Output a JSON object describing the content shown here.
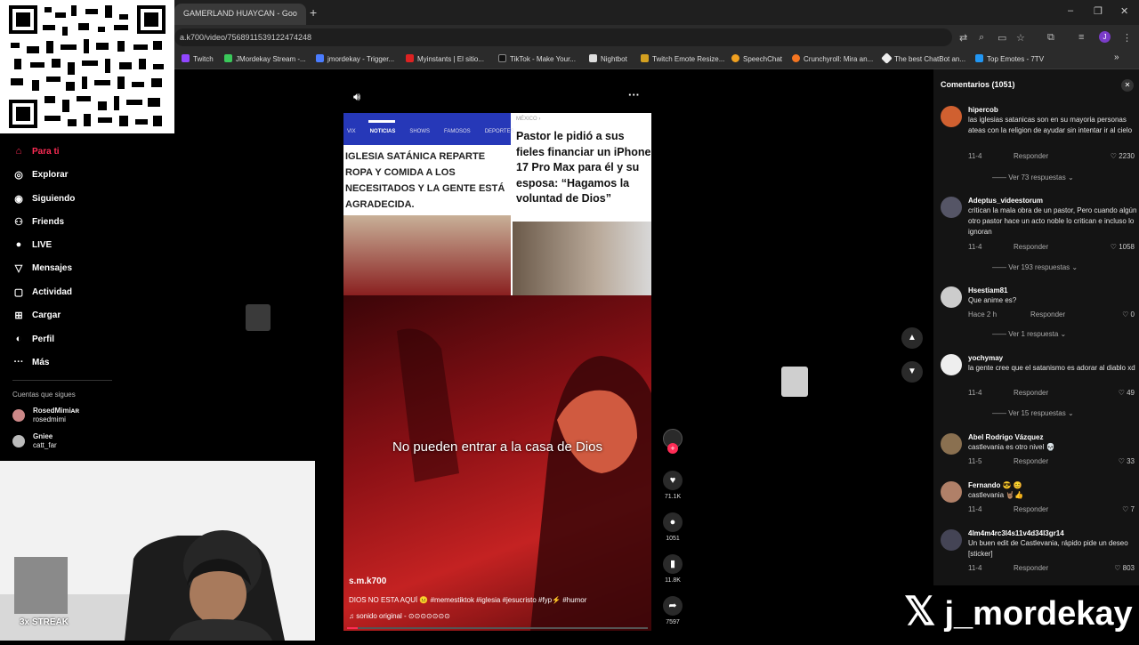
{
  "browser": {
    "tab_title": "GAMERLAND HUAYCAN - Goo",
    "url": "a.k700/video/7568911539122474248",
    "bookmarks": [
      "Twitch",
      "JMordekay Stream -...",
      "jmordekay - Trigger...",
      "Myinstants | El sitio...",
      "TikTok - Make Your...",
      "Nightbot",
      "Twitch Emote Resize...",
      "SpeechChat",
      "Crunchyroll: Mira an...",
      "The best ChatBot an...",
      "Top Emotes - 7TV"
    ]
  },
  "sidebar": {
    "items": [
      {
        "icon": "home-icon",
        "label": "Para ti"
      },
      {
        "icon": "compass-icon",
        "label": "Explorar"
      },
      {
        "icon": "following-icon",
        "label": "Siguiendo"
      },
      {
        "icon": "friends-icon",
        "label": "Friends"
      },
      {
        "icon": "live-icon",
        "label": "LIVE"
      },
      {
        "icon": "messages-icon",
        "label": "Mensajes"
      },
      {
        "icon": "activity-icon",
        "label": "Actividad"
      },
      {
        "icon": "upload-icon",
        "label": "Cargar"
      },
      {
        "icon": "profile-icon",
        "label": "Perfil"
      },
      {
        "icon": "more-icon",
        "label": "Más"
      }
    ],
    "following_heading": "Cuentas que sigues",
    "following": [
      {
        "name": "RosedMimiᴀʀ",
        "handle": "rosedmimi"
      },
      {
        "name": "Gniee",
        "handle": "catt_far"
      }
    ]
  },
  "video": {
    "tabs": [
      "VIX",
      "NOTICIAS",
      "SHOWS",
      "FAMOSOS",
      "DEPORTES"
    ],
    "left_headline": "IGLESIA SATÁNICA REPARTE ROPA Y COMIDA A LOS NECESITADOS Y LA GENTE ESTÁ AGRADECIDA.",
    "right_kicker": "MÉXICO ›",
    "right_headline": "Pastor le pidió a sus fieles financiar un iPhone 17 Pro Max para él y su esposa: “Hagamos la voluntad de Dios”",
    "subtitle": "No pueden entrar a la casa de Dios",
    "author": "s.m.k700",
    "caption": "DIOS NO ESTA AQUÍ 😐 #memestiktok #iglesia #jesucristo #fyp⚡ #humor",
    "sound": "sonido original - ⊙⊙⊙⊙⊙⊙⊙",
    "likes": "71.1K",
    "comments": "1051",
    "saves": "11.8K",
    "shares": "7597"
  },
  "comments_panel": {
    "title": "Comentarios (1051)",
    "items": [
      {
        "user": "hipercob",
        "text": "las iglesias satanicas son en su mayoria personas ateas con la religion de ayudar sin intentar ir al cielo",
        "date": "11-4",
        "reply": "Responder",
        "likes": "2230",
        "more": "Ver 73 respuestas"
      },
      {
        "user": "Adeptus_videestorum",
        "text": "critican la mala obra de un pastor, Pero cuando algún otro pastor hace un acto noble lo critican e incluso lo ignoran",
        "date": "11-4",
        "reply": "Responder",
        "likes": "1058",
        "more": "Ver 193 respuestas"
      },
      {
        "user": "Hsestiam81",
        "text": "Que anime es?",
        "date": "Hace 2 h",
        "reply": "Responder",
        "likes": "0",
        "more": "Ver 1 respuesta"
      },
      {
        "user": "yochymay",
        "text": "la gente cree que el satanismo es adorar al diablo xd",
        "date": "11-4",
        "reply": "Responder",
        "likes": "49",
        "more": "Ver 15 respuestas"
      },
      {
        "user": "Abel Rodrigo Vázquez",
        "text": "castlevania es otro nivel 💀",
        "date": "11-5",
        "reply": "Responder",
        "likes": "33",
        "more": ""
      },
      {
        "user": "Fernando 😎 😊",
        "text": "castlevania 🤘🏽👍",
        "date": "11-4",
        "reply": "Responder",
        "likes": "7",
        "more": ""
      },
      {
        "user": "4lm4m4rc3l4s11v4d34l3gr14",
        "text": "Un buen edit de Castlevania, rápido pide un deseo [sticker]",
        "date": "11-4",
        "reply": "Responder",
        "likes": "803",
        "more": ""
      }
    ]
  },
  "overlay": {
    "streak": "3x STREAK",
    "watermark": "j_mordekay"
  }
}
